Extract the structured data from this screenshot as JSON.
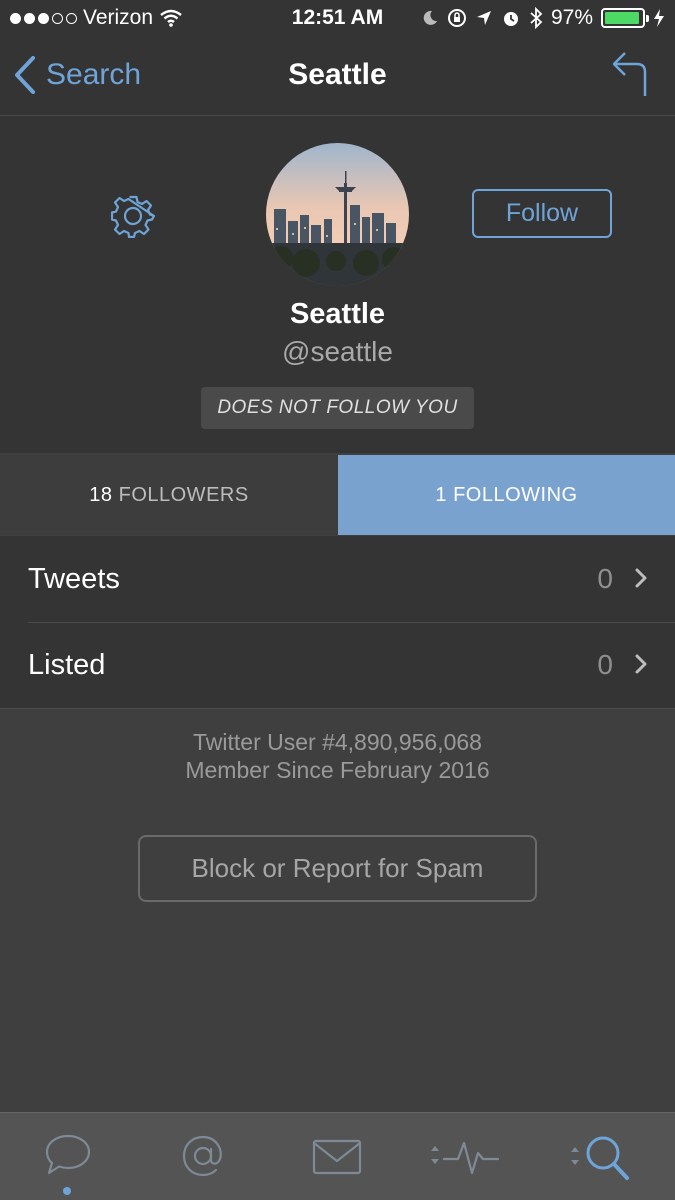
{
  "status_bar": {
    "carrier": "Verizon",
    "time": "12:51 AM",
    "battery": "97%"
  },
  "nav": {
    "back_label": "Search",
    "title": "Seattle"
  },
  "profile": {
    "follow_label": "Follow",
    "display_name": "Seattle",
    "handle": "@seattle",
    "follow_status": "DOES NOT FOLLOW YOU"
  },
  "tabs": {
    "followers_count": "18",
    "followers_label": "FOLLOWERS",
    "following_count": "1",
    "following_label": "FOLLOWING"
  },
  "list": [
    {
      "label": "Tweets",
      "count": "0"
    },
    {
      "label": "Listed",
      "count": "0"
    }
  ],
  "meta": {
    "user_number": "Twitter User #4,890,956,068",
    "member_since": "Member Since February 2016"
  },
  "spam_button_label": "Block or Report for Spam",
  "tab_bar": [
    "timeline-icon",
    "mentions-icon",
    "messages-icon",
    "activity-icon",
    "search-icon"
  ],
  "colors": {
    "accent": "#6fa4d8",
    "background": "#3f3f3f",
    "panel": "#343434",
    "following_tab": "#79a2cf"
  }
}
